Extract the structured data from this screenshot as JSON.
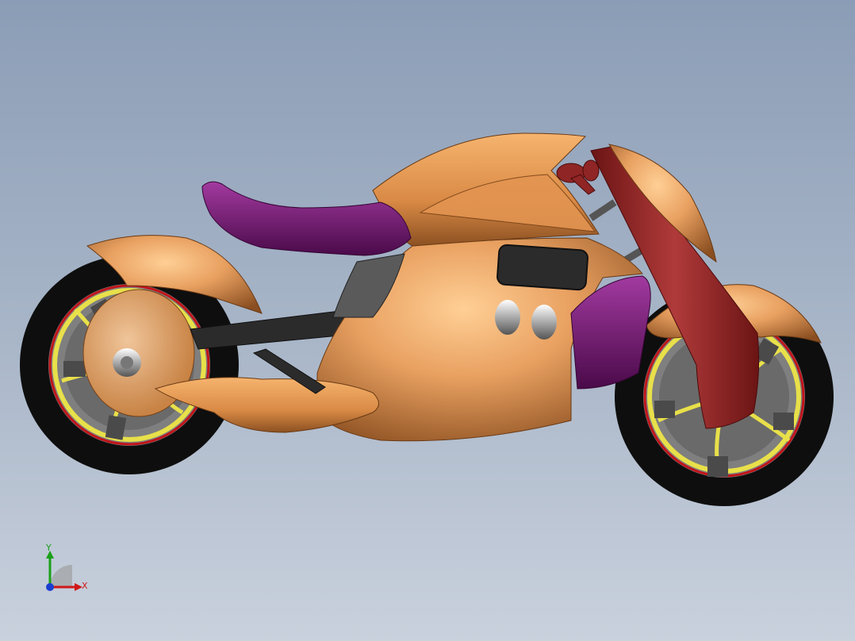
{
  "viewport": {
    "background_top": "#8b9db6",
    "background_bottom": "#c9d1dd"
  },
  "model": {
    "body_color": "#e49a56",
    "seat_color": "#7d1a7a",
    "fork_color": "#8f2525",
    "tire_color": "#111111",
    "rim_accent": "#e8e04a",
    "rim_stripe": "#c0141a"
  },
  "triad": {
    "x_label": "X",
    "y_label": "Y",
    "x_color": "#d01818",
    "y_color": "#19a019",
    "z_color": "#1a3fd0"
  }
}
